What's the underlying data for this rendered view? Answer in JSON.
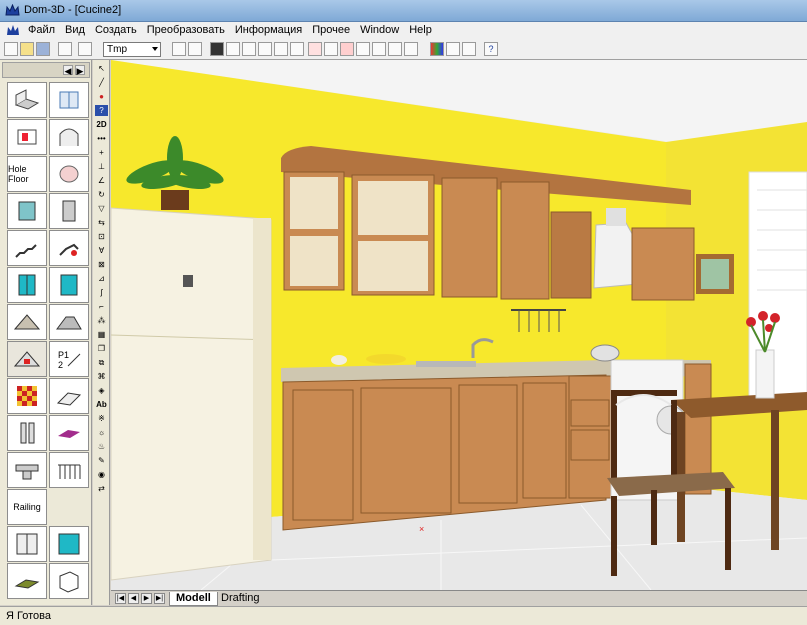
{
  "window": {
    "title": "Dom-3D - [Cucine2]"
  },
  "menu": {
    "items": [
      "Файл",
      "Вид",
      "Создать",
      "Преобразовать",
      "Информация",
      "Прочее",
      "Window",
      "Help"
    ]
  },
  "toolbar": {
    "combo_value": "Tmp"
  },
  "palette": {
    "hole_floor_label": "Hole Floor",
    "railing_label": "Railing"
  },
  "vstrip": {
    "label_2d": "2D",
    "label_ab": "Ab"
  },
  "tabs": {
    "model": "Modell",
    "drafting": "Drafting"
  },
  "status": {
    "text": "Я Готова"
  },
  "colors": {
    "wall_yellow": "#f7e82c",
    "cabinet_wood": "#c88550",
    "fridge": "#f6f2e2",
    "floor": "#e8e8e8"
  }
}
